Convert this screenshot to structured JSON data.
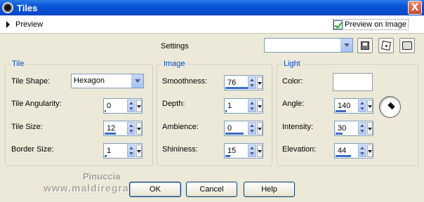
{
  "window": {
    "title": "Tiles",
    "close_label": "X"
  },
  "preview": {
    "label": "Preview",
    "preview_on_image_label": "Preview on Image",
    "preview_on_image_checked": true
  },
  "settings": {
    "label": "Settings",
    "preset_value": ""
  },
  "tile": {
    "group_title": "Tile",
    "shape_label": "Tile Shape:",
    "shape_value": "Hexagon",
    "angularity_label": "Tile Angularity:",
    "angularity_value": "0",
    "size_label": "Tile Size:",
    "size_value": "12",
    "border_label": "Border Size:",
    "border_value": "1"
  },
  "image": {
    "group_title": "Image",
    "smoothness_label": "Smoothness:",
    "smoothness_value": "76",
    "depth_label": "Depth:",
    "depth_value": "1",
    "ambience_label": "Ambience:",
    "ambience_value": "0",
    "shininess_label": "Shininess:",
    "shininess_value": "15"
  },
  "light": {
    "group_title": "Light",
    "color_label": "Color:",
    "color_value": "#ffffff",
    "angle_label": "Angle:",
    "angle_value": "140",
    "intensity_label": "Intensity:",
    "intensity_value": "30",
    "elevation_label": "Elevation:",
    "elevation_value": "44"
  },
  "buttons": {
    "ok": "OK",
    "cancel": "Cancel",
    "help": "Help"
  },
  "watermark": {
    "name": "Pinuccia",
    "url": "www.maldiregrafite.eu"
  },
  "colors": {
    "titlebar": "#0a54d8",
    "group_title": "#0046d5",
    "dialog_bg": "#ece9d8"
  },
  "icons": [
    "app-icon",
    "save-icon",
    "randomize-icon",
    "reset-icon",
    "angle-dial-icon"
  ]
}
